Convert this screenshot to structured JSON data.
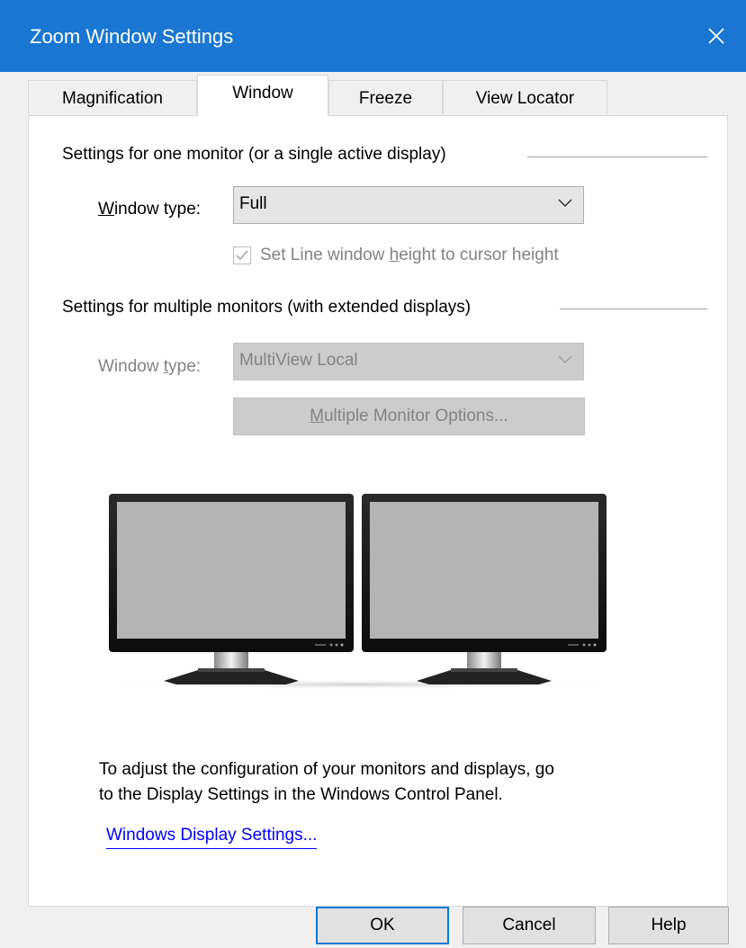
{
  "window": {
    "title": "Zoom Window Settings",
    "close_icon": "close-icon",
    "accent_color": "#1976d2"
  },
  "tabs": [
    {
      "label": "Magnification",
      "active": false
    },
    {
      "label": "Window",
      "active": true
    },
    {
      "label": "Freeze",
      "active": false
    },
    {
      "label": "View Locator",
      "active": false
    }
  ],
  "single_monitor": {
    "section_title": "Settings for one monitor (or a single active display)",
    "window_type_label_mnemonic": "W",
    "window_type_label_rest": "indow type:",
    "window_type_value": "Full",
    "checkbox_label_before": "Set Line window ",
    "checkbox_label_mnemonic": "h",
    "checkbox_label_after": "eight to cursor height",
    "checkbox_checked": true,
    "checkbox_enabled": false
  },
  "multi_monitor": {
    "section_title": "Settings for multiple monitors (with extended displays)",
    "window_type_label_before": "Window ",
    "window_type_label_mnemonic": "t",
    "window_type_label_after": "ype:",
    "window_type_value": "MultiView Local",
    "options_button_mnemonic": "M",
    "options_button_rest": "ultiple Monitor Options...",
    "enabled": false
  },
  "info": {
    "line1": "To adjust the configuration of your monitors and displays, go",
    "line2": "to the Display Settings in the Windows Control Panel.",
    "link": "Windows Display Settings..."
  },
  "footer": {
    "ok": "OK",
    "cancel": "Cancel",
    "help": "Help"
  }
}
